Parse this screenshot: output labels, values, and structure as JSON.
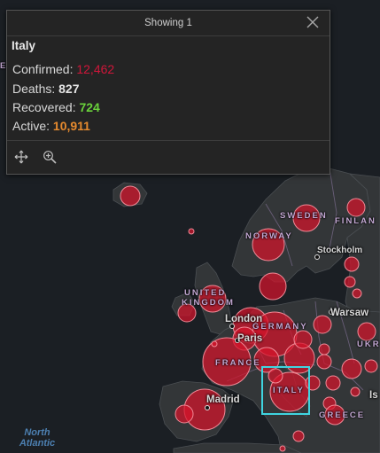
{
  "popup": {
    "header": "Showing 1",
    "close_icon": "close-icon",
    "country": "Italy",
    "stats": [
      {
        "label": "Confirmed:",
        "value": "12,462",
        "color": "#d0163a"
      },
      {
        "label": "Deaths:",
        "value": "827",
        "color": "#e6e6e6"
      },
      {
        "label": "Recovered:",
        "value": "724",
        "color": "#6ad23b"
      },
      {
        "label": "Active:",
        "value": "10,911",
        "color": "#e68a2e"
      }
    ],
    "tools": [
      "pan-icon",
      "zoom-to-icon"
    ]
  },
  "map": {
    "countries": {
      "sweden": "SWEDEN",
      "finland": "FINLAN",
      "norway": "NORWAY",
      "uk_1": "UNITED",
      "uk_2": "KINGDOM",
      "germany": "GERMANY",
      "france": "FRANCE",
      "italy": "ITALY",
      "greece": "GREECE",
      "ukraine": "UKR",
      "edge_e": "E"
    },
    "cities": {
      "stockholm": "Stockholm",
      "warsaw": "Warsaw",
      "london": "London",
      "paris": "Paris",
      "madrid": "Madrid",
      "edge_is": "Is"
    },
    "sea": {
      "line1": "North",
      "line2": "Atlantic"
    },
    "bubble_color": "#d5142b",
    "selection_color": "#3fd4e0"
  }
}
